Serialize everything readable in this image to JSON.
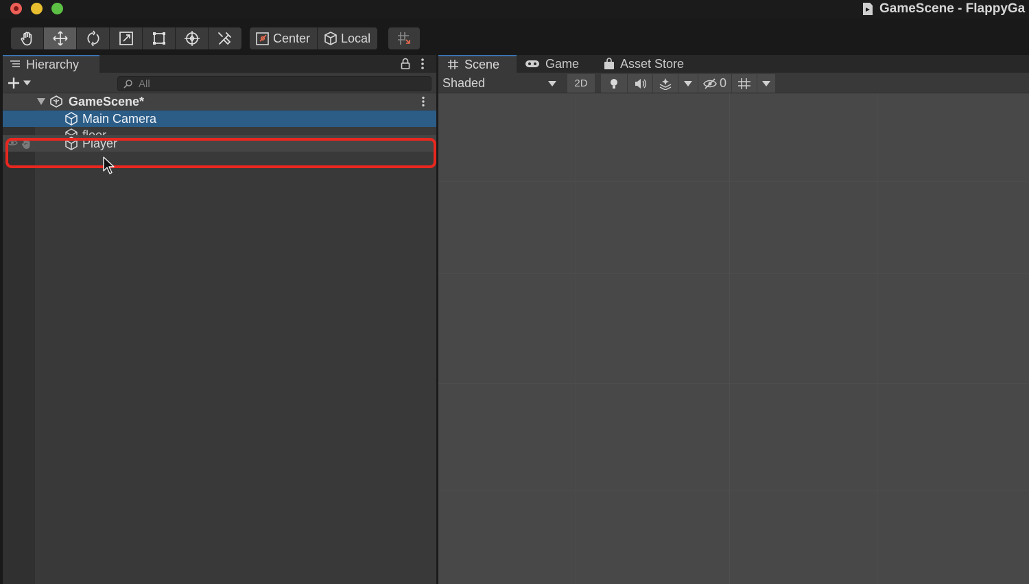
{
  "window": {
    "title": "GameScene - FlappyGa"
  },
  "toolbar": {
    "tools": [
      "hand-tool",
      "move-tool",
      "rotate-tool",
      "scale-tool",
      "rect-tool",
      "transform-tool",
      "custom-tool"
    ],
    "active_tool": "move-tool",
    "pivot_label": "Center",
    "space_label": "Local"
  },
  "hierarchy": {
    "tab_label": "Hierarchy",
    "search_placeholder": "All",
    "scene_name": "GameScene*",
    "items": [
      {
        "label": "Main Camera",
        "selected": true
      },
      {
        "label": "floor",
        "selected": false
      },
      {
        "label": "Player",
        "selected": false,
        "hovered": true
      }
    ]
  },
  "scene_view": {
    "tabs": [
      {
        "label": "Scene",
        "active": true
      },
      {
        "label": "Game",
        "active": false
      },
      {
        "label": "Asset Store",
        "active": false
      }
    ],
    "shading_mode": "Shaded",
    "two_d_label": "2D",
    "hidden_count": "0"
  },
  "colors": {
    "selection": "#2c5d87",
    "annotation": "#e8271f",
    "tab_accent": "#3a72b0"
  }
}
